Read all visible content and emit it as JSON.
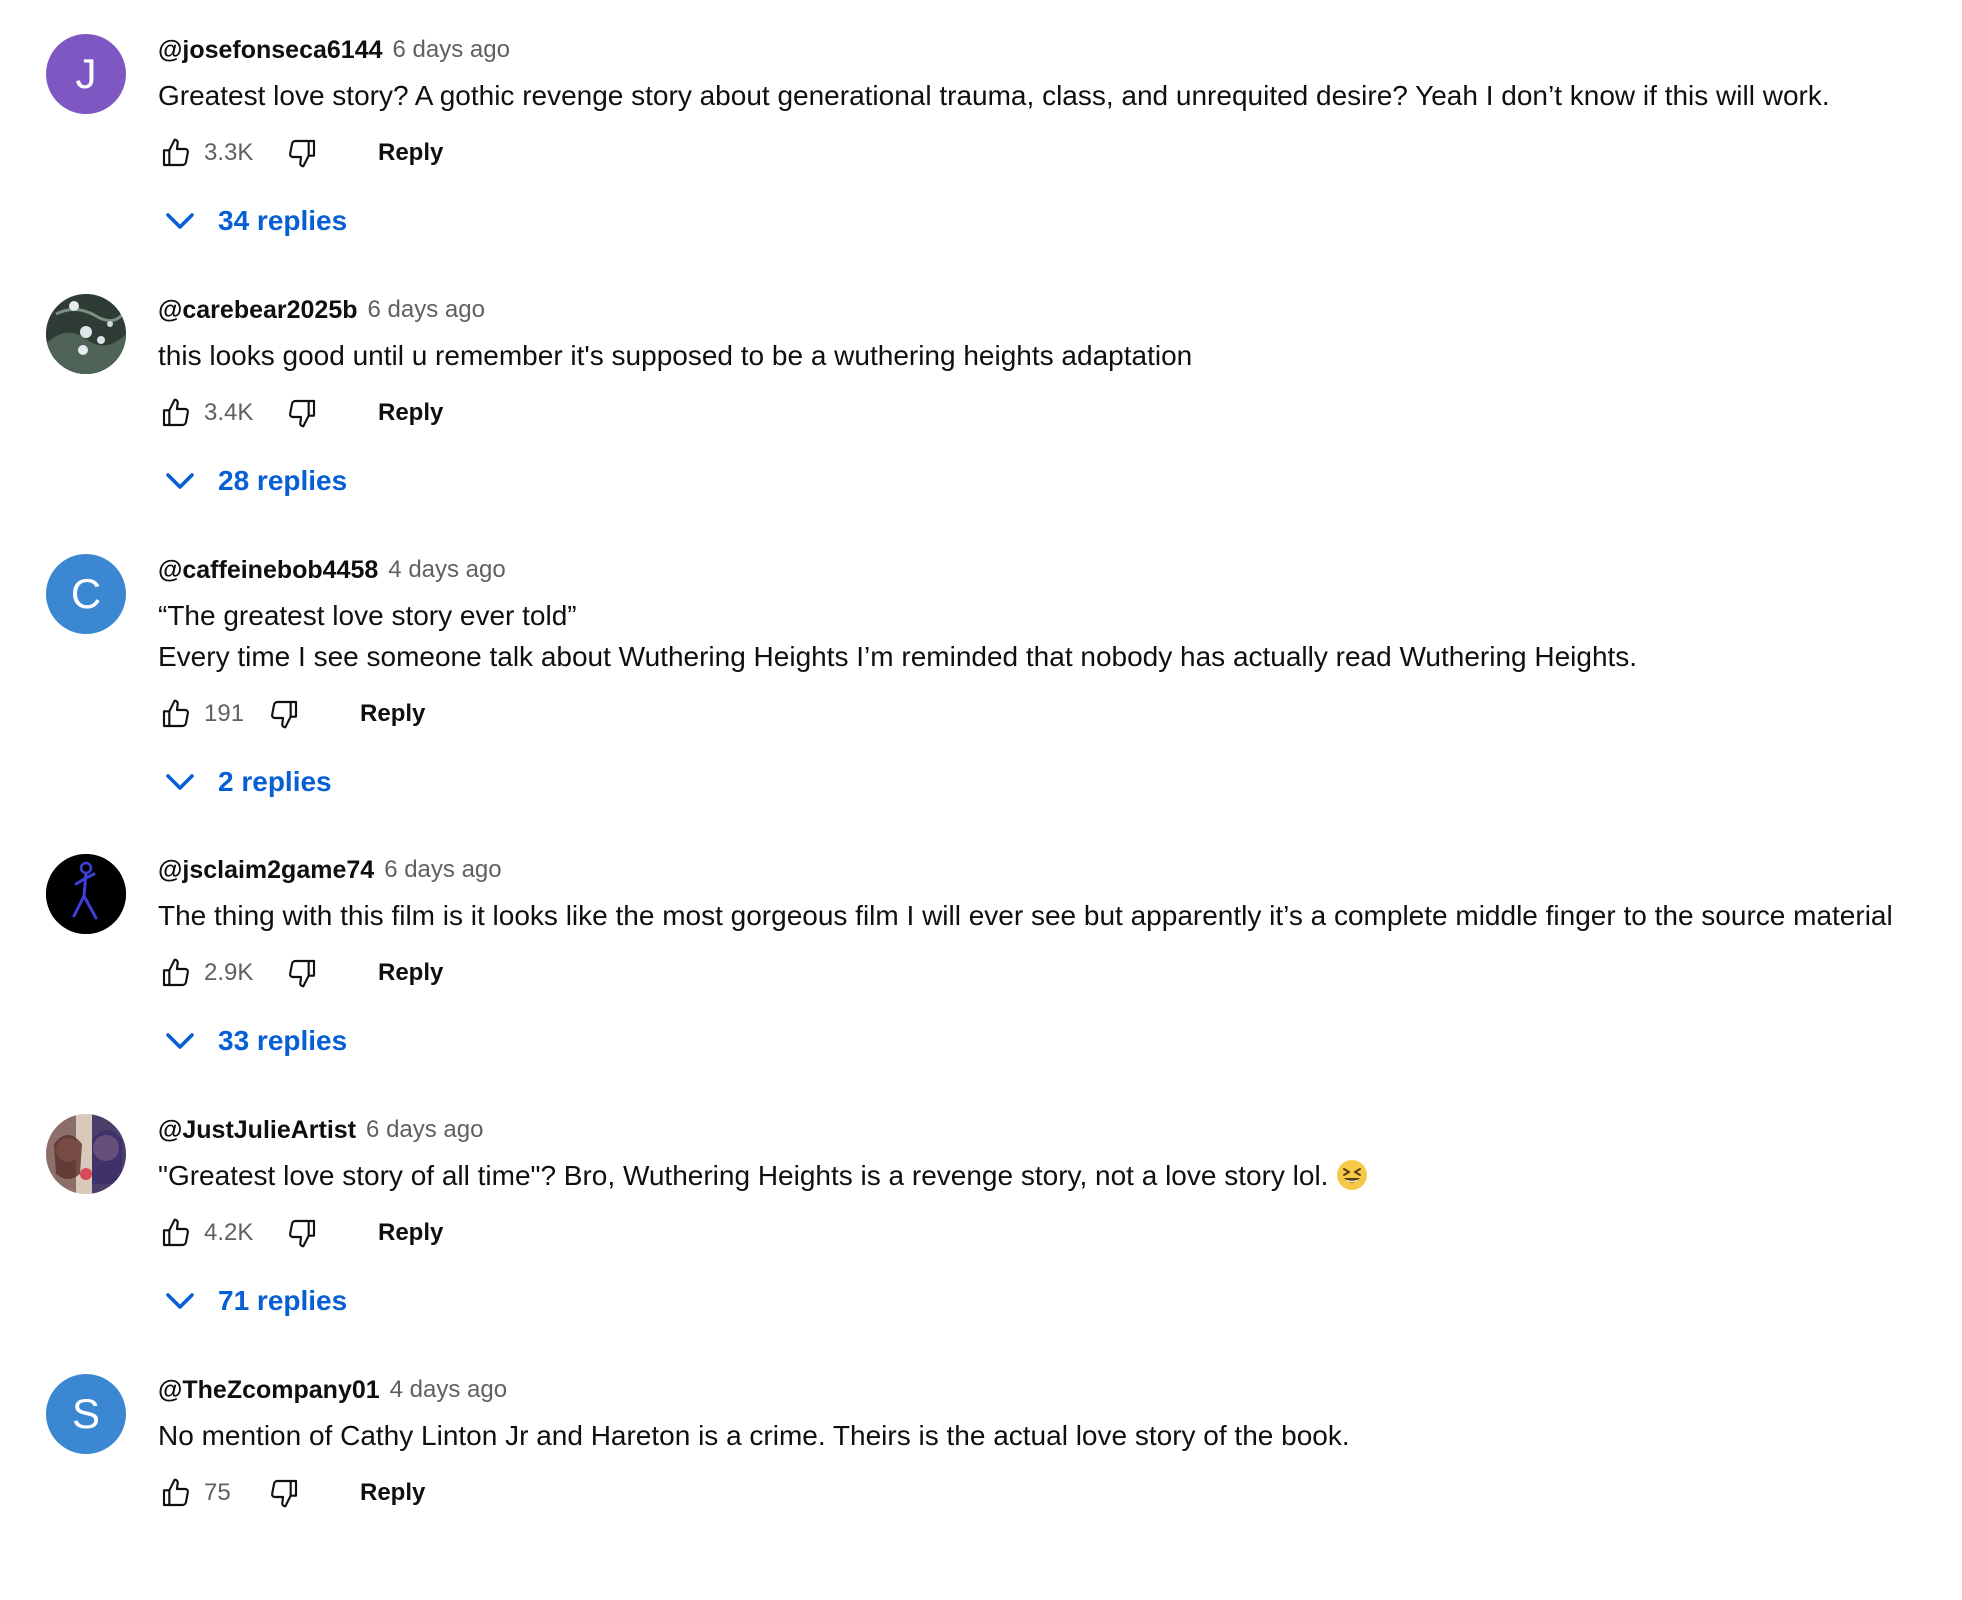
{
  "comments": [
    {
      "handle": "@josefonseca6144",
      "time": "6 days ago",
      "avatar_letter": "J",
      "avatar_color": "#7e57c2",
      "lines": [
        "Greatest love story? A gothic revenge story about generational trauma, class, and unrequited desire? Yeah I don’t know if this will work."
      ],
      "likes": "3.3K",
      "reply_label": "Reply",
      "replies": "34 replies"
    },
    {
      "handle": "@carebear2025b",
      "time": "6 days ago",
      "avatar_letter": "",
      "avatar_color": "#2f3b35",
      "lines": [
        "this looks good until u remember it's supposed to be a wuthering heights adaptation"
      ],
      "likes": "3.4K",
      "reply_label": "Reply",
      "replies": "28 replies"
    },
    {
      "handle": "@caffeinebob4458",
      "time": "4 days ago",
      "avatar_letter": "C",
      "avatar_color": "#3b87d2",
      "lines": [
        "“The greatest love story ever told”",
        "Every time I see someone talk about Wuthering Heights I’m reminded that nobody has actually read Wuthering Heights."
      ],
      "likes": "191",
      "reply_label": "Reply",
      "replies": "2 replies"
    },
    {
      "handle": "@jsclaim2game74",
      "time": "6 days ago",
      "avatar_letter": "",
      "avatar_color": "#000000",
      "lines": [
        "The thing with this film is it looks like the most gorgeous film I will ever see but apparently it’s a complete middle finger to the source material"
      ],
      "likes": "2.9K",
      "reply_label": "Reply",
      "replies": "33 replies"
    },
    {
      "handle": "@JustJulieArtist",
      "time": "6 days ago",
      "avatar_letter": "",
      "avatar_color": "#c9b7a6",
      "lines": [
        "\"Greatest love story of all time\"? Bro, Wuthering Heights is a revenge story, not a love story lol."
      ],
      "emoji": "laughing-squinting-face",
      "likes": "4.2K",
      "reply_label": "Reply",
      "replies": "71 replies"
    },
    {
      "handle": "@TheZcompany01",
      "time": "4 days ago",
      "avatar_letter": "S",
      "avatar_color": "#3b87d2",
      "lines": [
        "No mention of Cathy Linton Jr and Hareton is a crime. Theirs is the actual love story of the book."
      ],
      "likes": "75",
      "reply_label": "Reply",
      "replies": ""
    }
  ],
  "colors": {
    "link": "#065fd4",
    "meta": "#606060",
    "text": "#0f0f0f"
  },
  "icons": {
    "like": "thumbs-up-icon",
    "dislike": "thumbs-down-icon",
    "expand": "chevron-down-icon"
  }
}
